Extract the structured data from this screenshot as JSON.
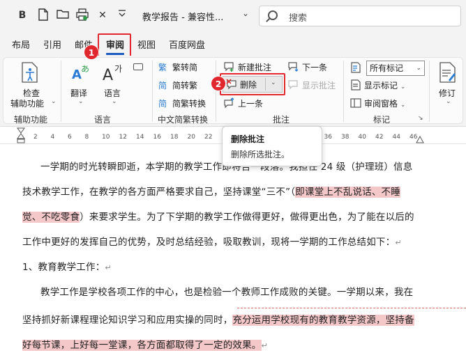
{
  "titlebar": {
    "icons": [
      "bold-icon",
      "new-doc-icon",
      "open-folder-icon",
      "print-icon",
      "close-x-icon",
      "customize-icon"
    ],
    "bold_glyph": "B",
    "doc_title": "教学报告 - 兼容性...",
    "search_placeholder": "搜索"
  },
  "tabs": [
    {
      "label": "布局"
    },
    {
      "label": "引用"
    },
    {
      "label": "邮件"
    },
    {
      "label": "审阅",
      "active": true
    },
    {
      "label": "视图"
    },
    {
      "label": "百度网盘"
    }
  ],
  "badges": {
    "one": "1",
    "two": "2"
  },
  "ribbon": {
    "accessibility": {
      "label_line1": "检查",
      "label_line2": "辅助功能",
      "group": "辅助功能"
    },
    "language": {
      "translate": "翻译",
      "language": "语言",
      "group": "语言"
    },
    "chinese": {
      "trad": "繁转简",
      "simp": "简转繁",
      "convert": "简繁转换",
      "group": "中文简繁转换"
    },
    "comments": {
      "new": "新建批注",
      "delete": "删除",
      "previous": "上一条",
      "next": "下一条",
      "show": "显示批注",
      "group": "批注"
    },
    "tracking": {
      "select_value": "所有标记",
      "show_markup": "显示标记",
      "review_pane": "审阅窗格",
      "group": "标记",
      "revise": "修订"
    }
  },
  "tooltip": {
    "title": "删除批注",
    "desc": "删除所选批注。"
  },
  "ruler": {
    "numbers": [
      "2",
      "4",
      "6",
      "8",
      "10",
      "12",
      "14",
      "16",
      "18",
      "20",
      "22",
      "24",
      "26",
      "28",
      "30",
      "32",
      "34",
      "36",
      "38",
      "40",
      "42",
      "44",
      "46"
    ]
  },
  "document": {
    "l1": "一学期的时光转瞬即逝，本学期的教学工作即将告一段落。我担任 24 级（护理班）信息",
    "l2a": "技术教学工作，在教学的各方面严格要求自己，坚持课堂“三不”（",
    "l2b": "即课堂上不乱说话、不睡",
    "l3a": "觉、不吃零食",
    "l3b": "）来要求学生。为了下学期的教学工作做得更好，做得更出色，为了能在以后的",
    "l4": "工作中更好的发挥自己的优势，及时总结经验，吸取教训，现将一学期的工作总结如下：",
    "l5": "1、教育教学工作：",
    "l6": "教学工作是学校各项工作的中心，也是检验一个教师工作成败的关键。一学期以来，我在",
    "l7a": "坚持抓好新课程理论知识学习和应用实操的同时，",
    "l7b": "充分运用学校现有的教育教学资源，坚持备",
    "l8": "好每节课，上好每一堂课，各方面都取得了一定的效果。",
    "para_mark": "↵"
  }
}
